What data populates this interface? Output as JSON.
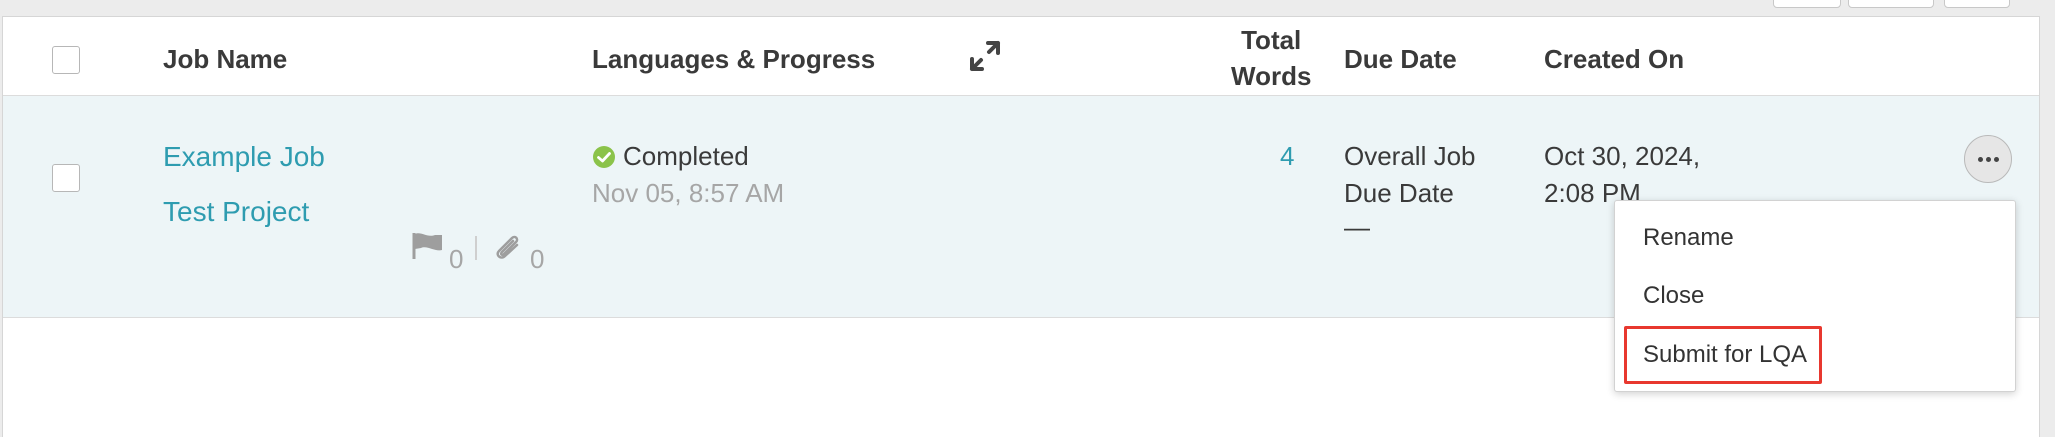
{
  "table": {
    "headers": {
      "job_name": "Job Name",
      "languages_progress": "Languages & Progress",
      "total_words_line1": "Total",
      "total_words_line2": "Words",
      "due_date": "Due Date",
      "created_on": "Created On"
    },
    "icons": {
      "expand": "expand-arrows-icon",
      "status": "check-circle-icon",
      "flag": "flag-icon",
      "attachment": "paperclip-icon",
      "more": "ellipsis-icon"
    },
    "rows": [
      {
        "job_name": "Example Job",
        "project_name": "Test Project",
        "flag_count": "0",
        "attachment_count": "0",
        "status": "Completed",
        "status_date": "Nov 05, 8:57 AM",
        "total_words": "4",
        "due_date_line1": "Overall Job",
        "due_date_line2": "Due Date",
        "due_date_value": "—",
        "created_on_line1": "Oct 30, 2024,",
        "created_on_line2": "2:08 PM"
      }
    ]
  },
  "context_menu": {
    "items": [
      "Rename",
      "Close",
      "Submit for LQA"
    ]
  },
  "colors": {
    "link": "#2e9cb0",
    "row_background": "#edf5f7",
    "status_green": "#8bc34a",
    "highlight": "#e8382f"
  }
}
